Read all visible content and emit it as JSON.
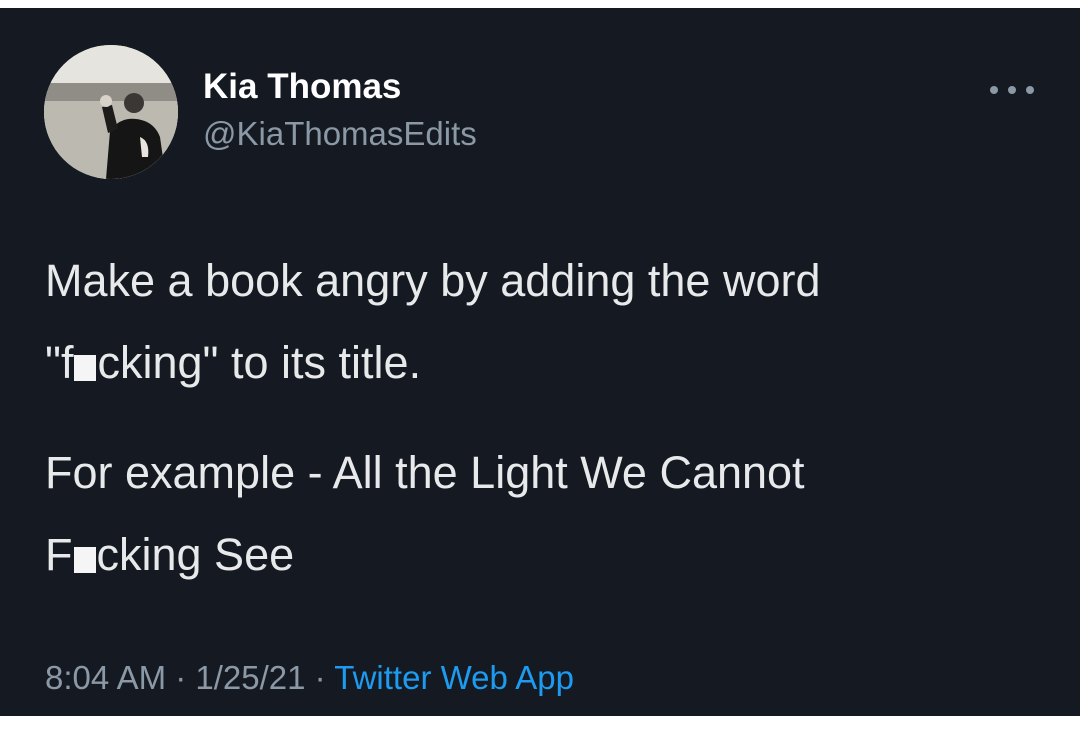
{
  "author": {
    "display_name": "Kia Thomas",
    "handle": "@KiaThomasEdits",
    "avatar_icon": "profile-photo"
  },
  "tweet": {
    "paragraph1_line1": "Make a book angry by adding the word",
    "paragraph1_line2_a": "\"f",
    "paragraph1_line2_b": "cking\" to its title.",
    "paragraph2_line1": "For example - All the Light We Cannot",
    "paragraph2_line2_a": "F",
    "paragraph2_line2_b": "cking See"
  },
  "meta": {
    "time": "8:04 AM",
    "separator": " · ",
    "date": "1/25/21",
    "source": "Twitter Web App"
  },
  "colors": {
    "background": "#151a22",
    "text": "#e7e9ea",
    "secondary": "#8b98a5",
    "link": "#1d9bf0"
  },
  "more_icon": "more-horizontal-icon"
}
